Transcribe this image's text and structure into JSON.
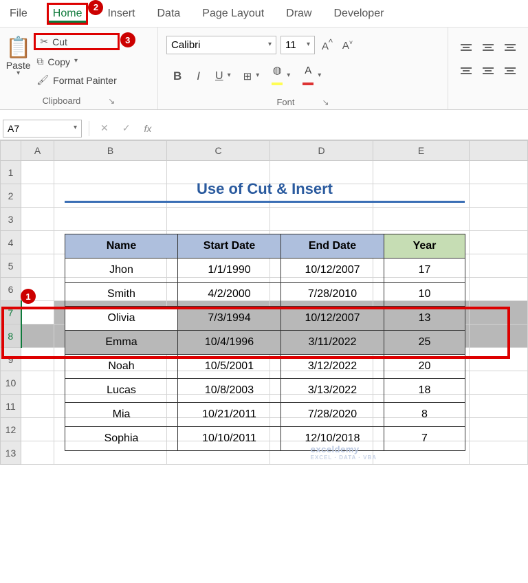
{
  "tabs": [
    "File",
    "Home",
    "Insert",
    "Data",
    "Page Layout",
    "Draw",
    "Developer"
  ],
  "active_tab": "Home",
  "clipboard": {
    "paste": "Paste",
    "cut": "Cut",
    "copy": "Copy",
    "format_painter": "Format Painter",
    "group_label": "Clipboard"
  },
  "font": {
    "name": "Calibri",
    "size": "11",
    "group_label": "Font"
  },
  "namebox": "A7",
  "cols": [
    "A",
    "B",
    "C",
    "D",
    "E"
  ],
  "rows": [
    "1",
    "2",
    "3",
    "4",
    "5",
    "6",
    "7",
    "8",
    "9",
    "10",
    "11",
    "12",
    "13"
  ],
  "selected_rows": [
    "7",
    "8"
  ],
  "title": "Use of Cut & Insert",
  "headers": [
    "Name",
    "Start Date",
    "End Date",
    "Year"
  ],
  "data": [
    {
      "name": "Jhon",
      "start": "1/1/1990",
      "end": "10/12/2007",
      "year": "17"
    },
    {
      "name": "Smith",
      "start": "4/2/2000",
      "end": "7/28/2010",
      "year": "10"
    },
    {
      "name": "Olivia",
      "start": "7/3/1994",
      "end": "10/12/2007",
      "year": "13"
    },
    {
      "name": "Emma",
      "start": "10/4/1996",
      "end": "3/11/2022",
      "year": "25"
    },
    {
      "name": "Noah",
      "start": "10/5/2001",
      "end": "3/12/2022",
      "year": "20"
    },
    {
      "name": "Lucas",
      "start": "10/8/2003",
      "end": "3/13/2022",
      "year": "18"
    },
    {
      "name": "Mia",
      "start": "10/21/2011",
      "end": "7/28/2020",
      "year": "8"
    },
    {
      "name": "Sophia",
      "start": "10/10/2011",
      "end": "12/10/2018",
      "year": "7"
    }
  ],
  "badges": {
    "b1": "1",
    "b2": "2",
    "b3": "3"
  },
  "watermark": {
    "main": "exceldemy",
    "sub": "EXCEL · DATA · VBA"
  }
}
